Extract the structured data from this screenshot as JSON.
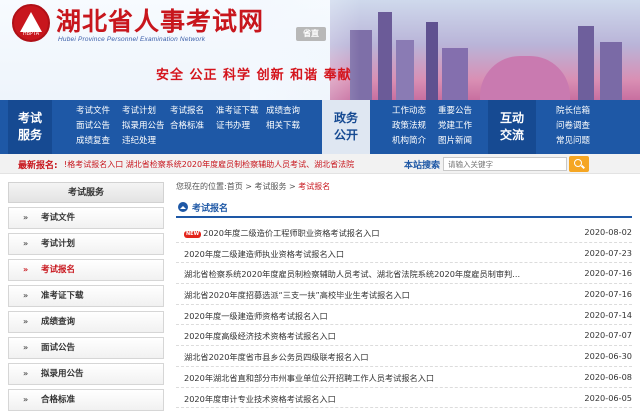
{
  "header": {
    "title": "湖北省人事考试网",
    "subtitle": "Hubei Province Personnel Examination Network",
    "logo_text": "HBPTA",
    "region_button": "省直",
    "slogan": "安全 公正 科学 创新 和谐 奉献"
  },
  "nav": {
    "sections": [
      {
        "heading": [
          "考试",
          "服务"
        ],
        "links": [
          "考试文件",
          "考试计划",
          "考试报名",
          "准考证下载",
          "成绩查询",
          "面试公告",
          "拟录用公告",
          "合格标准",
          "证书办理",
          "相关下载",
          "成绩复查",
          "违纪处理"
        ]
      },
      {
        "heading": [
          "政务",
          "公开"
        ],
        "links": [
          "工作动态",
          "重要公告",
          "政策法规",
          "党建工作",
          "机构简介",
          "图片新闻"
        ]
      },
      {
        "heading": [
          "互动",
          "交流"
        ],
        "links": [
          "院长信箱",
          "问卷调查",
          "常见问题"
        ]
      }
    ]
  },
  "latest": {
    "label": "最新报名:",
    "ticker": "!格考试报名入口    湖北省检察系统2020年度雇员制检察辅助人员考试、湖北省法院"
  },
  "search": {
    "label": "本站搜索",
    "placeholder": "请输入关键字"
  },
  "sidebar": {
    "heading": "考试服务",
    "items": [
      "考试文件",
      "考试计划",
      "考试报名",
      "准考证下载",
      "成绩查询",
      "面试公告",
      "拟录用公告",
      "合格标准"
    ],
    "active": "考试报名"
  },
  "breadcrumb": {
    "prefix": "您现在的位置:",
    "home": "首页",
    "parent": "考试服务",
    "current": "考试报名",
    "sep": " > "
  },
  "section_title": "考试报名",
  "list": {
    "new_badge": "NEW",
    "items": [
      {
        "title": "2020年度二级造价工程师职业资格考试报名入口",
        "date": "2020-08-02",
        "is_new": true
      },
      {
        "title": "2020年度二级建造师执业资格考试报名入口",
        "date": "2020-07-23",
        "is_new": false
      },
      {
        "title": "湖北省检察系统2020年度雇员制检察辅助人员考试、湖北省法院系统2020年度雇员制审判...",
        "date": "2020-07-16",
        "is_new": false
      },
      {
        "title": "湖北省2020年度招募选派“三支一扶”高校毕业生考试报名入口",
        "date": "2020-07-16",
        "is_new": false
      },
      {
        "title": "2020年度一级建造师资格考试报名入口",
        "date": "2020-07-14",
        "is_new": false
      },
      {
        "title": "2020年度高级经济技术资格考试报名入口",
        "date": "2020-07-07",
        "is_new": false
      },
      {
        "title": "湖北省2020年度省市县乡公务员四级联考报名入口",
        "date": "2020-06-30",
        "is_new": false
      },
      {
        "title": "2020年湖北省直和部分市州事业单位公开招聘工作人员考试报名入口",
        "date": "2020-06-08",
        "is_new": false
      },
      {
        "title": "2020年度审计专业技术资格考试报名入口",
        "date": "2020-06-05",
        "is_new": false
      }
    ]
  },
  "colors": {
    "brand_red": "#c8161d",
    "nav_blue": "#1e58a6",
    "search_orange": "#f5a623"
  }
}
